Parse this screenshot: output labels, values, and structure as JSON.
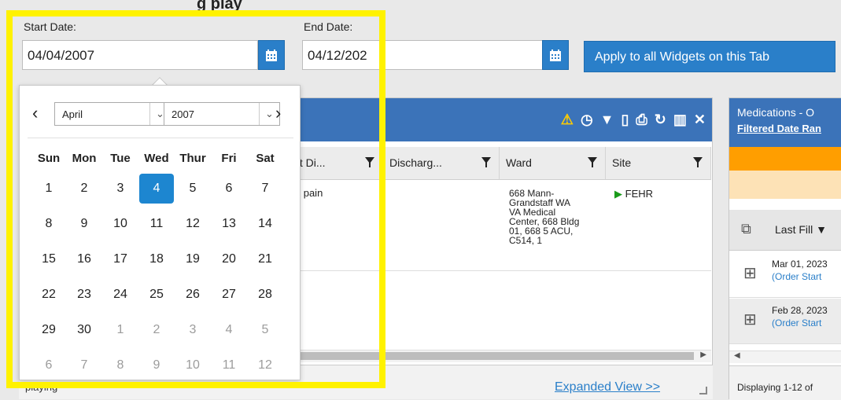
{
  "page_title": "g                                                    play",
  "start_date": {
    "label": "Start Date:",
    "value": "04/04/2007"
  },
  "end_date": {
    "label": "End Date:",
    "value": "04/12/202"
  },
  "apply_button": "Apply to all Widgets on this Tab",
  "encounters": {
    "columns": [
      "nit Di...",
      "Discharg...",
      "Ward",
      "Site"
    ],
    "row": {
      "reason": "st pain",
      "ward": "668 Mann-\nGrandstaff WA\nVA Medical\nCenter, 668 Bldg\n01, 668 5 ACU,\nC514, 1",
      "site": "FEHR"
    },
    "footer_left": "playing",
    "expanded_view": "Expanded View >>"
  },
  "medications": {
    "title": "Medications - O",
    "filter_link": "Filtered Date Ran",
    "last_fill": "Last Fill",
    "rows": [
      {
        "date": "Mar 01, 2023",
        "sub": "(Order Start"
      },
      {
        "date": "Feb 28, 2023",
        "sub": "(Order Start"
      }
    ],
    "footer": "Displaying 1-12 of"
  },
  "calendar": {
    "month": "April",
    "year": "2007",
    "weekdays": [
      "Sun",
      "Mon",
      "Tue",
      "Wed",
      "Thur",
      "Fri",
      "Sat"
    ],
    "weeks": [
      [
        "1",
        "2",
        "3",
        "4",
        "5",
        "6",
        "7"
      ],
      [
        "8",
        "9",
        "10",
        "11",
        "12",
        "13",
        "14"
      ],
      [
        "15",
        "16",
        "17",
        "18",
        "19",
        "20",
        "21"
      ],
      [
        "22",
        "23",
        "24",
        "25",
        "26",
        "27",
        "28"
      ],
      [
        "29",
        "30",
        "1",
        "2",
        "3",
        "4",
        "5"
      ],
      [
        "6",
        "7",
        "8",
        "9",
        "10",
        "11",
        "12"
      ]
    ],
    "selected_day": "4",
    "highlight_color": "#fff200"
  },
  "colors": {
    "accent": "#2a7fc9",
    "header_blue": "#3b73b9",
    "warning": "#ffcc00",
    "orange_band": "#ff9e00",
    "site_green": "#1a9b1a"
  }
}
